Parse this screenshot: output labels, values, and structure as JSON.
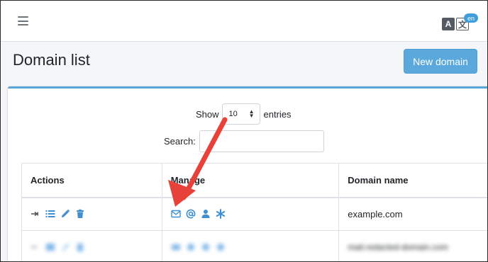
{
  "header": {
    "lang_badge": "en",
    "lang_a": "A",
    "lang_b": "文"
  },
  "page": {
    "title": "Domain list",
    "new_button": "New domain"
  },
  "controls": {
    "show_label": "Show",
    "entries_value": "10",
    "entries_label": "entries",
    "search_label": "Search:",
    "search_value": ""
  },
  "table": {
    "columns": [
      "Actions",
      "Manage",
      "Domain name"
    ],
    "rows": [
      {
        "domain": "example.com",
        "action_icons": [
          "expand-icon",
          "list-icon",
          "edit-pencil-icon",
          "trash-icon"
        ],
        "manage_icons": [
          "envelope-icon",
          "at-sign-icon",
          "user-icon",
          "asterisk-icon"
        ]
      },
      {
        "domain": "mail.redacted-domain.com",
        "action_icons": [
          "expand-icon",
          "list-icon",
          "edit-pencil-icon",
          "trash-icon"
        ],
        "manage_icons": [
          "envelope-icon",
          "at-sign-icon",
          "user-icon",
          "asterisk-icon"
        ]
      }
    ]
  },
  "colors": {
    "accent": "#3f8fd2",
    "button": "#5ba9dc",
    "arrow": "#e8413a"
  }
}
